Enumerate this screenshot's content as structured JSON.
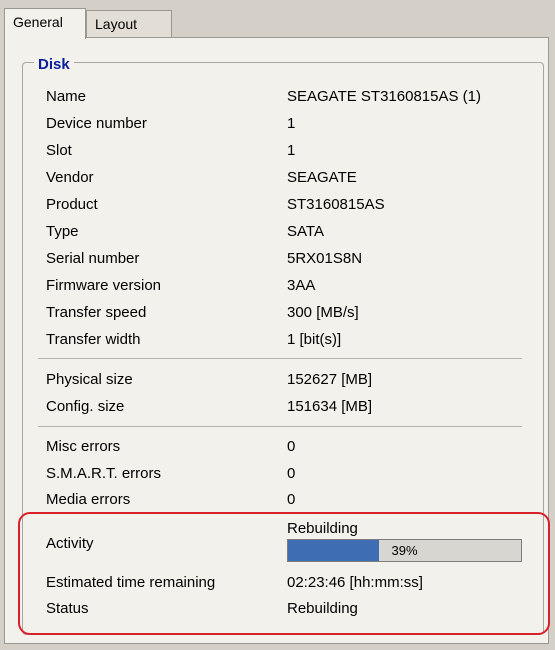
{
  "tabs": [
    {
      "label": "General",
      "active": true
    },
    {
      "label": "Layout",
      "active": false
    }
  ],
  "group": {
    "title": "Disk"
  },
  "disk_info": [
    {
      "label": "Name",
      "value": "SEAGATE ST3160815AS (1)"
    },
    {
      "label": "Device number",
      "value": "1"
    },
    {
      "label": "Slot",
      "value": "1"
    },
    {
      "label": "Vendor",
      "value": "SEAGATE"
    },
    {
      "label": "Product",
      "value": "ST3160815AS"
    },
    {
      "label": "Type",
      "value": "SATA"
    },
    {
      "label": "Serial number",
      "value": "5RX01S8N"
    },
    {
      "label": "Firmware version",
      "value": "3AA"
    },
    {
      "label": "Transfer speed",
      "value": "300 [MB/s]"
    },
    {
      "label": "Transfer width",
      "value": "1 [bit(s)]"
    }
  ],
  "size_info": [
    {
      "label": "Physical size",
      "value": "152627 [MB]"
    },
    {
      "label": "Config. size",
      "value": "151634 [MB]"
    }
  ],
  "errors": [
    {
      "label": "Misc errors",
      "value": "0"
    },
    {
      "label": "S.M.A.R.T. errors",
      "value": "0"
    },
    {
      "label": "Media errors",
      "value": "0"
    }
  ],
  "activity": {
    "label": "Activity",
    "status": "Rebuilding",
    "progress_percent": 39,
    "progress_text": "39%"
  },
  "estimated": {
    "label": "Estimated time remaining",
    "value": "02:23:46 [hh:mm:ss]"
  },
  "status": {
    "label": "Status",
    "value": "Rebuilding"
  },
  "colors": {
    "progress_fill": "#3e6db3",
    "highlight": "#d8202a",
    "group_title": "#0a1e9c"
  }
}
